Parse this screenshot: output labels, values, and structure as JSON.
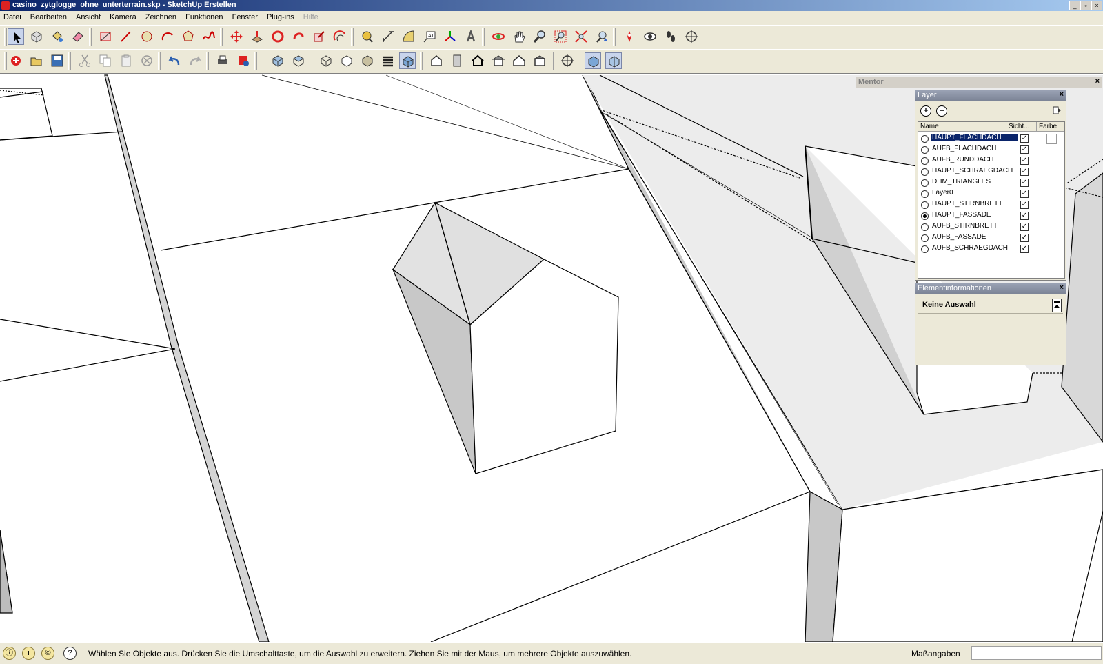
{
  "window": {
    "title": "casino_zytglogge_ohne_unterterrain.skp - SketchUp Erstellen",
    "controls": [
      "_",
      "▫",
      "×"
    ]
  },
  "menu": [
    "Datei",
    "Bearbeiten",
    "Ansicht",
    "Kamera",
    "Zeichnen",
    "Funktionen",
    "Fenster",
    "Plug-ins",
    "Hilfe"
  ],
  "toolbar1": [
    "select",
    "component",
    "paint-bucket",
    "eraser",
    "rectangle",
    "line",
    "circle",
    "arc",
    "polygon",
    "freehand",
    "move",
    "push-pull",
    "rotate",
    "follow-me",
    "scale",
    "offset",
    "tape-measure",
    "dimension",
    "protractor",
    "text",
    "axes",
    "3d-text",
    "orbit",
    "pan",
    "zoom",
    "zoom-window",
    "zoom-extents",
    "previous",
    "position-camera",
    "look-around",
    "walk",
    "section-plane"
  ],
  "toolbar2": [
    "new",
    "open",
    "save",
    "cut",
    "copy",
    "paste",
    "delete",
    "undo",
    "redo",
    "print",
    "model-info",
    "iso",
    "top",
    "front",
    "right",
    "back",
    "left",
    "xray",
    "wireframe",
    "hidden-line",
    "shaded",
    "shaded-textures",
    "monochrome",
    "warehouse",
    "door",
    "house1",
    "house2",
    "house3",
    "house4",
    "section-display",
    "section-fill",
    "section-cut"
  ],
  "mentor": {
    "title": "Mentor"
  },
  "layer_panel": {
    "title": "Layer",
    "columns": [
      "Name",
      "Sicht...",
      "Farbe"
    ],
    "layers": [
      {
        "name": "HAUPT_FLACHDACH",
        "visible": true,
        "active": false,
        "selected": true
      },
      {
        "name": "AUFB_FLACHDACH",
        "visible": true,
        "active": false,
        "selected": false
      },
      {
        "name": "AUFB_RUNDDACH",
        "visible": true,
        "active": false,
        "selected": false
      },
      {
        "name": "HAUPT_SCHRAEGDACH",
        "visible": true,
        "active": false,
        "selected": false
      },
      {
        "name": "DHM_TRIANGLES",
        "visible": true,
        "active": false,
        "selected": false
      },
      {
        "name": "Layer0",
        "visible": true,
        "active": false,
        "selected": false
      },
      {
        "name": "HAUPT_STIRNBRETT",
        "visible": true,
        "active": false,
        "selected": false
      },
      {
        "name": "HAUPT_FASSADE",
        "visible": true,
        "active": true,
        "selected": false
      },
      {
        "name": "AUFB_STIRNBRETT",
        "visible": true,
        "active": false,
        "selected": false
      },
      {
        "name": "AUFB_FASSADE",
        "visible": true,
        "active": false,
        "selected": false
      },
      {
        "name": "AUFB_SCHRAEGDACH",
        "visible": true,
        "active": false,
        "selected": false
      }
    ]
  },
  "info_panel": {
    "title": "Elementinformationen",
    "content": "Keine Auswahl"
  },
  "status": {
    "message": "Wählen Sie Objekte aus. Drücken Sie die Umschalttaste, um die Auswahl zu erweitern. Ziehen Sie mit der Maus, um mehrere Objekte auszuwählen.",
    "measurements_label": "Maßangaben",
    "measurements_value": ""
  },
  "colors": {
    "face": "#d9d9d9",
    "edge": "#000000",
    "selection": "#0a246a",
    "titlebar": "#0a246a"
  }
}
